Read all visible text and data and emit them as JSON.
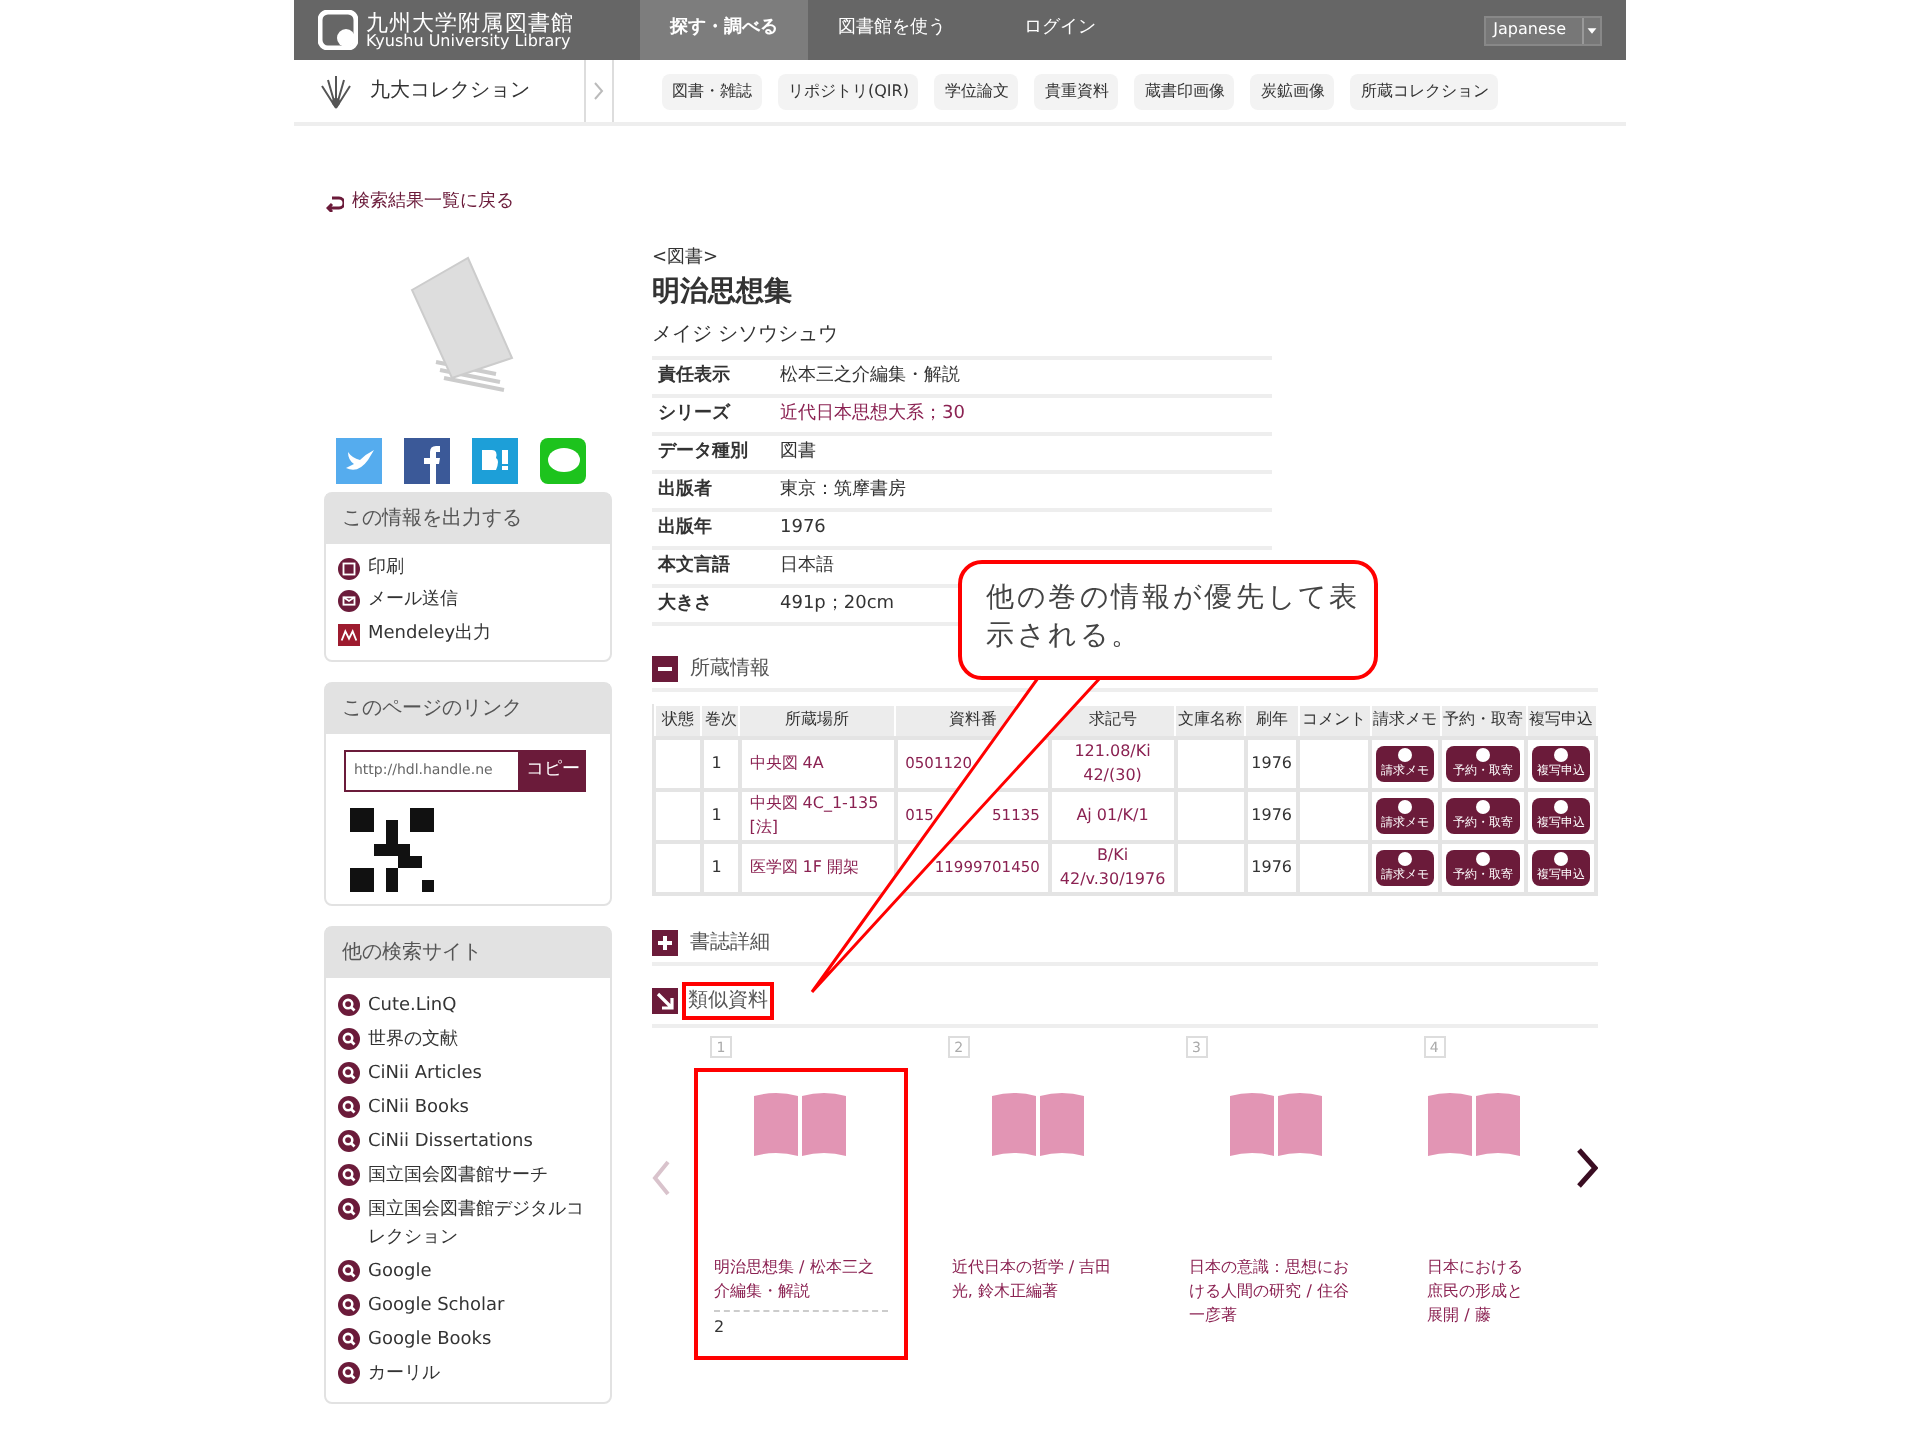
{
  "header": {
    "logo_title": "九州大学附属図書館",
    "logo_subtitle": "Kyushu University Library",
    "nav": [
      {
        "label": "探す・調べる",
        "selected": true
      },
      {
        "label": "図書館を使う",
        "selected": false
      },
      {
        "label": "ログイン",
        "selected": false
      }
    ],
    "language": "Japanese"
  },
  "subnav": {
    "collection": "九大コレクション",
    "links": [
      "図書・雑誌",
      "リポジトリ(QIR)",
      "学位論文",
      "貴重資料",
      "蔵書印画像",
      "炭鉱画像",
      "所蔵コレクション"
    ]
  },
  "back_link": "検索結果一覧に戻る",
  "record": {
    "type": "<図書>",
    "title": "明治思想集",
    "reading": "メイジ シソウシュウ",
    "fields": [
      {
        "label": "責任表示",
        "value": "松本三之介編集・解説",
        "link": false
      },
      {
        "label": "シリーズ",
        "value": "近代日本思想大系；30",
        "link": true
      },
      {
        "label": "データ種別",
        "value": "図書",
        "link": false
      },
      {
        "label": "出版者",
        "value": "東京：筑摩書房",
        "link": false
      },
      {
        "label": "出版年",
        "value": "1976",
        "link": false
      },
      {
        "label": "本文言語",
        "value": "日本語",
        "link": false
      },
      {
        "label": "大きさ",
        "value": "491p；20cm",
        "link": false
      }
    ]
  },
  "holdings": {
    "title": "所蔵情報",
    "expanded": true,
    "columns": [
      "状態",
      "巻次",
      "所蔵場所",
      "資料番",
      "求記号",
      "文庫名称",
      "刷年",
      "コメント",
      "請求メモ",
      "予約・取寄",
      "複写申込"
    ],
    "rows": [
      {
        "volume": "1",
        "location": "中央図 4A",
        "number": [
          "0501120"
        ],
        "call_number": "121.08/Ki 42/(30)",
        "year": "1976",
        "buttons": [
          "請求メモ",
          "予約・取寄",
          "複写申込"
        ]
      },
      {
        "volume": "1",
        "location": "中央図 4C_1-135 [法]",
        "number": [
          "015",
          "51135"
        ],
        "call_number": "Aj 01/K/1",
        "year": "1976",
        "buttons": [
          "請求メモ",
          "予約・取寄",
          "複写申込"
        ]
      },
      {
        "volume": "1",
        "location": "医学図 1F 開架",
        "number": [
          "11999701450"
        ],
        "call_number": "B/Ki 42/v.30/1976",
        "year": "1976",
        "buttons": [
          "請求メモ",
          "予約・取寄",
          "複写申込"
        ]
      }
    ]
  },
  "details": {
    "title": "書誌詳細",
    "expanded": false
  },
  "similar": {
    "title": "類似資料",
    "highlighted": true,
    "items": [
      {
        "number": "1",
        "title": "明治思想集 / 松本三之介編集・解説",
        "count": "2",
        "highlighted": true
      },
      {
        "number": "2",
        "title": "近代日本の哲学 / 吉田光, 鈴木正編著",
        "highlighted": false
      },
      {
        "number": "3",
        "title": "日本の意識：思想における人間の研究 / 住谷一彦著",
        "highlighted": false
      },
      {
        "number": "4",
        "title": "日本における庶民の形成と展開 / 藤",
        "highlighted": false
      }
    ]
  },
  "callout": "他の巻の情報が優先して表示される。",
  "sidebar": {
    "output": {
      "title": "この情報を出力する",
      "items": [
        {
          "kind": "print",
          "label": "印刷"
        },
        {
          "kind": "mail",
          "label": "メール送信"
        },
        {
          "kind": "mendeley",
          "label": "Mendeley出力"
        }
      ]
    },
    "link": {
      "title": "このページのリンク",
      "url": "http://hdl.handle.ne",
      "copy": "コピー"
    },
    "sites": {
      "title": "他の検索サイト",
      "items": [
        "Cute.LinQ",
        "世界の文献",
        "CiNii Articles",
        "CiNii Books",
        "CiNii Dissertations",
        "国立国会図書館サーチ",
        "国立国会図書館デジタルコレクション",
        "Google",
        "Google Scholar",
        "Google Books",
        "カーリル"
      ]
    }
  }
}
